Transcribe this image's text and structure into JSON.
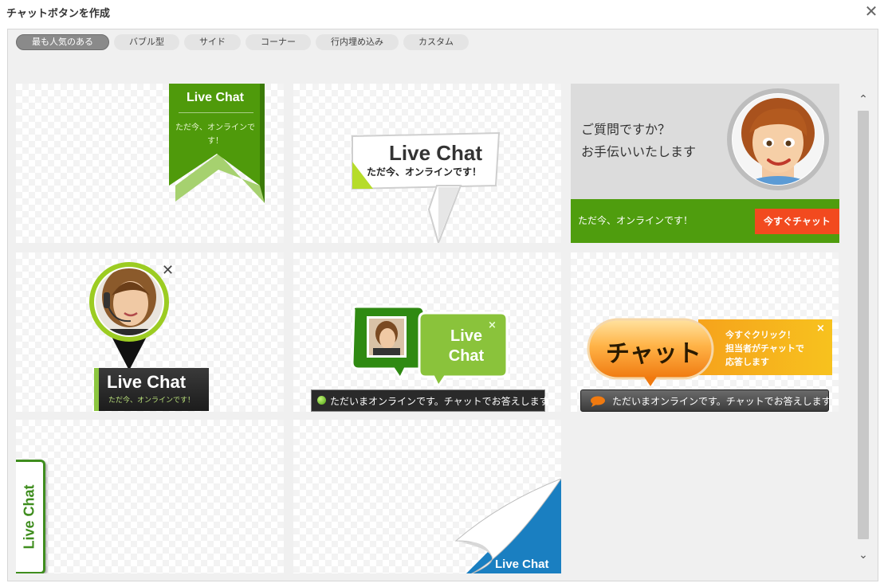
{
  "dialog": {
    "title": "チャットボタンを作成"
  },
  "tabs": [
    {
      "label": "最も人気のある"
    },
    {
      "label": "バブル型"
    },
    {
      "label": "サイド"
    },
    {
      "label": "コーナー"
    },
    {
      "label": "行内埋め込み"
    },
    {
      "label": "カスタム"
    }
  ],
  "cards": {
    "ribbon": {
      "title": "Live Chat",
      "subtitle": "ただ今、オンラインです！",
      "color": "#4f9a0b"
    },
    "bubble": {
      "title": "Live Chat",
      "subtitle": "ただ今、オンラインです！"
    },
    "agent_banner": {
      "question_line1": "ご質問ですか？",
      "question_line2": "お手伝いいたします",
      "online": "ただ今、オンラインです！",
      "button": "今すぐチャット",
      "accent": "#f24a1f"
    },
    "pin_avatar": {
      "title": "Live Chat",
      "subtitle": "ただ今、オンラインです！"
    },
    "speech_bubbles": {
      "title": "Live Chat",
      "status": "ただいまオンラインです。チャットでお答えします"
    },
    "orange_pill": {
      "pill": "チャット",
      "promo_line1": "今すぐクリック！",
      "promo_line2": "担当者がチャットで",
      "promo_line3": "応答します",
      "status": "ただいまオンラインです。チャットでお答えします"
    },
    "side_tab": {
      "title": "Live Chat"
    },
    "corner": {
      "title": "Live Chat",
      "color": "#1a7fc1"
    }
  },
  "icons": {
    "close": "close-icon",
    "scroll_up": "chevron-up-icon",
    "scroll_down": "chevron-down-icon",
    "close_glyph": "✕",
    "close_small_glyph": "×",
    "up_glyph": "⌃",
    "down_glyph": "⌄"
  }
}
